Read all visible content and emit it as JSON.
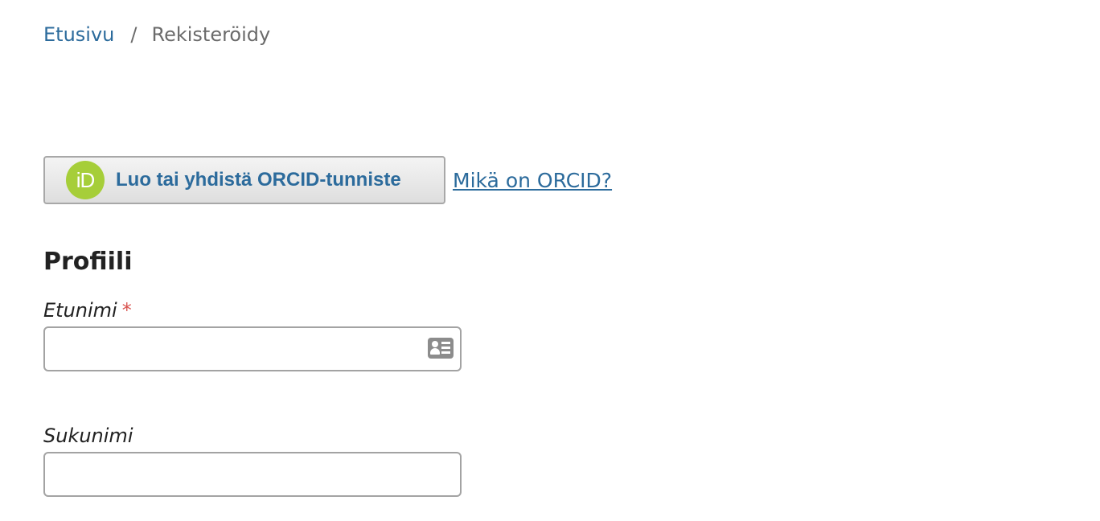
{
  "breadcrumb": {
    "home": "Etusivu",
    "separator": "/",
    "current": "Rekisteröidy"
  },
  "orcid": {
    "logo_text": "iD",
    "button_label": "Luo tai yhdistä ORCID-tunniste",
    "help_link": "Mikä on ORCID?"
  },
  "profile": {
    "title": "Profiili",
    "first_name": {
      "label": "Etunimi",
      "required_mark": "*",
      "value": "",
      "icon": "contact-card-icon"
    },
    "last_name": {
      "label": "Sukunimi",
      "value": ""
    }
  },
  "colors": {
    "link": "#2c6b9c",
    "required": "#d9534f",
    "orcid_green": "#a6ce39"
  }
}
